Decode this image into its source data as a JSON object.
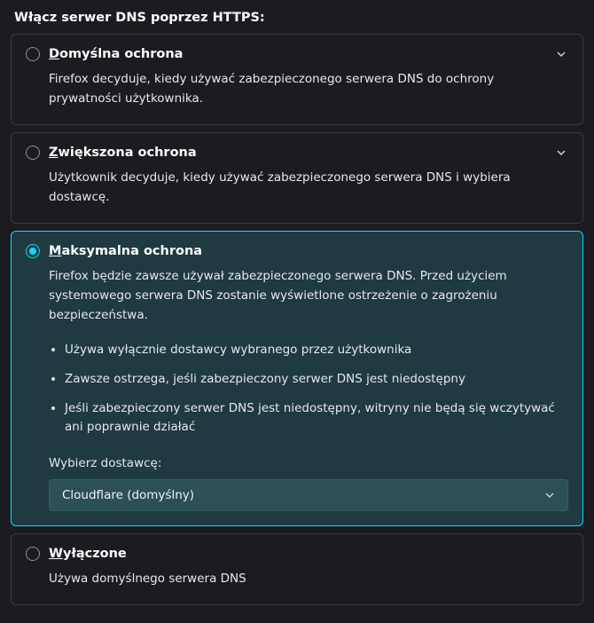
{
  "section_title": "Włącz serwer DNS poprzez HTTPS:",
  "options": {
    "default": {
      "accel": "D",
      "label_rest": "omyślna ochrona",
      "desc": "Firefox decyduje, kiedy używać zabezpieczonego serwera DNS do ochrony prywatności użytkownika."
    },
    "increased": {
      "accel": "Z",
      "label_rest": "większona ochrona",
      "desc": "Użytkownik decyduje, kiedy używać zabezpieczonego serwera DNS i wybiera dostawcę."
    },
    "max": {
      "accel": "M",
      "label_rest": "aksymalna ochrona",
      "desc": "Firefox będzie zawsze używał zabezpieczonego serwera DNS. Przed użyciem systemowego serwera DNS zostanie wyświetlone ostrzeżenie o zagrożeniu bezpieczeństwa.",
      "bullets": [
        "Używa wyłącznie dostawcy wybranego przez użytkownika",
        "Zawsze ostrzega, jeśli zabezpieczony serwer DNS jest niedostępny",
        "Jeśli zabezpieczony serwer DNS jest niedostępny, witryny nie będą się wczytywać ani poprawnie działać"
      ],
      "provider_label": "Wybierz dostawcę:",
      "provider_value": "Cloudflare (domyślny)"
    },
    "off": {
      "accel": "W",
      "label_rest": "yłączone",
      "desc": "Używa domyślnego serwera DNS"
    }
  }
}
